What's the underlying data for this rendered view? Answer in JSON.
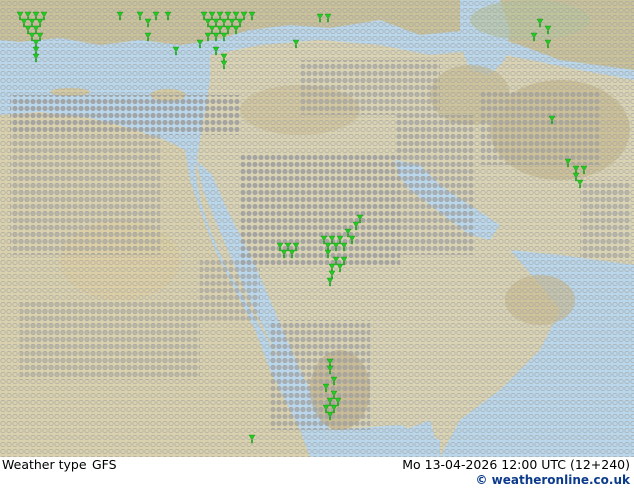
{
  "footer": {
    "label": "Weather type",
    "model": "GFS",
    "valid_time": "Mo 13-04-2026 12:00 UTC (12+240)",
    "credit": "© weatheronline.co.uk"
  },
  "colors": {
    "sea": "#b9d6ea",
    "lowland": "#d9d3b4",
    "desert": "#d8c79b",
    "highland": "#c7b98c",
    "mountain": "#b3a57d",
    "green_land": "#b9c9a0",
    "cloud_symbol": "#9e9e9e",
    "overcast_symbol": "#a8a8a8",
    "rain_symbol": "#22cc22"
  },
  "legend": {
    "symbols": [
      "clear-sky-circle-icon",
      "cloudy-dot-icon",
      "rain-shower-icon"
    ]
  }
}
